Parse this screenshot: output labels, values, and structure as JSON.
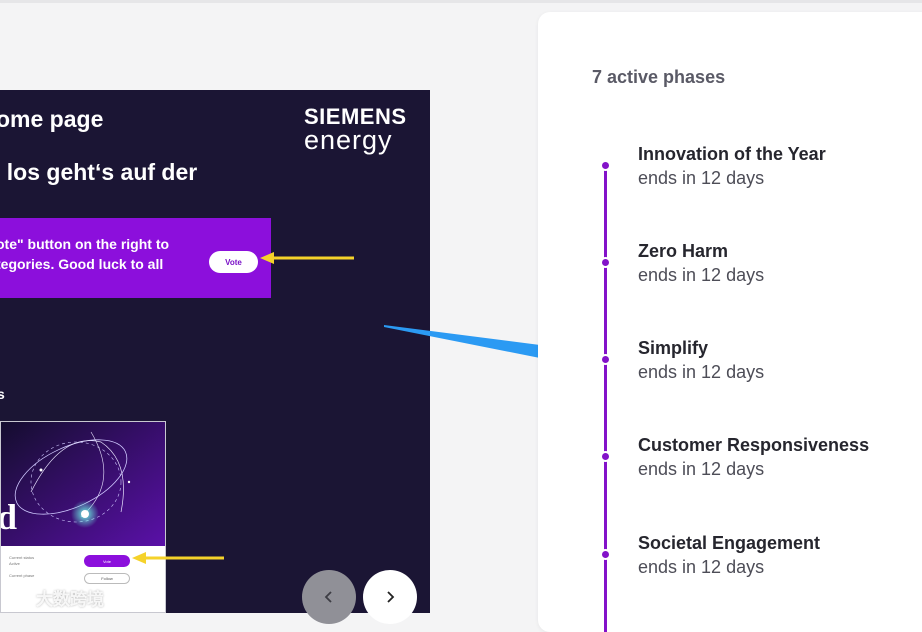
{
  "slide": {
    "title": "ome page",
    "subtitle": "l los geht‘s auf der",
    "logo": {
      "line1": "SIEMENS",
      "line2": "energy"
    },
    "banner": {
      "line1": "ote\" button on the right to",
      "line2": "tegories. Good luck to all",
      "vote_label": "Vote"
    },
    "section_label": "s",
    "preview": {
      "hero_letter": "d",
      "current_status_label": "Current status",
      "current_status_value": "Active",
      "current_phase_label": "Current phase",
      "vote_label": "Vote",
      "follow_label": "Follow"
    },
    "nav": {
      "prev_icon": "chevron-left-icon",
      "next_icon": "chevron-right-icon"
    },
    "annotation_colors": {
      "yellow_arrow": "#f5d22a",
      "blue_arrow": "#2b9af3"
    }
  },
  "watermark": {
    "text": "大数跨境"
  },
  "phases": {
    "count_label": "7 active phases",
    "accent_color": "#8312c9",
    "items": [
      {
        "name": "Innovation of the Year",
        "deadline": "ends in 12 days"
      },
      {
        "name": "Zero Harm",
        "deadline": "ends in 12 days"
      },
      {
        "name": "Simplify",
        "deadline": "ends in 12 days"
      },
      {
        "name": "Customer Responsiveness",
        "deadline": "ends in 12 days"
      },
      {
        "name": "Societal Engagement",
        "deadline": "ends in 12 days"
      }
    ]
  }
}
